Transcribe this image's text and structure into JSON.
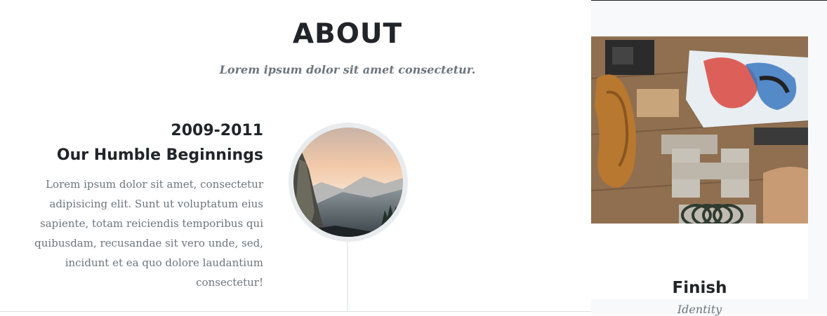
{
  "about": {
    "title": "ABOUT",
    "subtitle": "Lorem ipsum dolor sit amet consectetur."
  },
  "timeline": {
    "items": [
      {
        "year": "2009-2011",
        "heading": "Our Humble Beginnings",
        "body": "Lorem ipsum dolor sit amet, consectetur adipisicing elit. Sunt ut voluptatum eius sapiente, totam reiciendis temporibus qui quibusdam, recusandae sit vero unde, sed, incidunt et ea quo dolore laudantium consectetur!",
        "image_icon": "mountain-landscape-image"
      }
    ]
  },
  "portfolio": {
    "items": [
      {
        "title": "Finish",
        "subtitle": "Identity",
        "image_icon": "letterpress-tools-image"
      }
    ]
  },
  "colors": {
    "text_dark": "#212529",
    "text_muted": "#6c757d",
    "timeline_gray": "#e9ecef",
    "portfolio_bg": "#f8f9fa"
  }
}
